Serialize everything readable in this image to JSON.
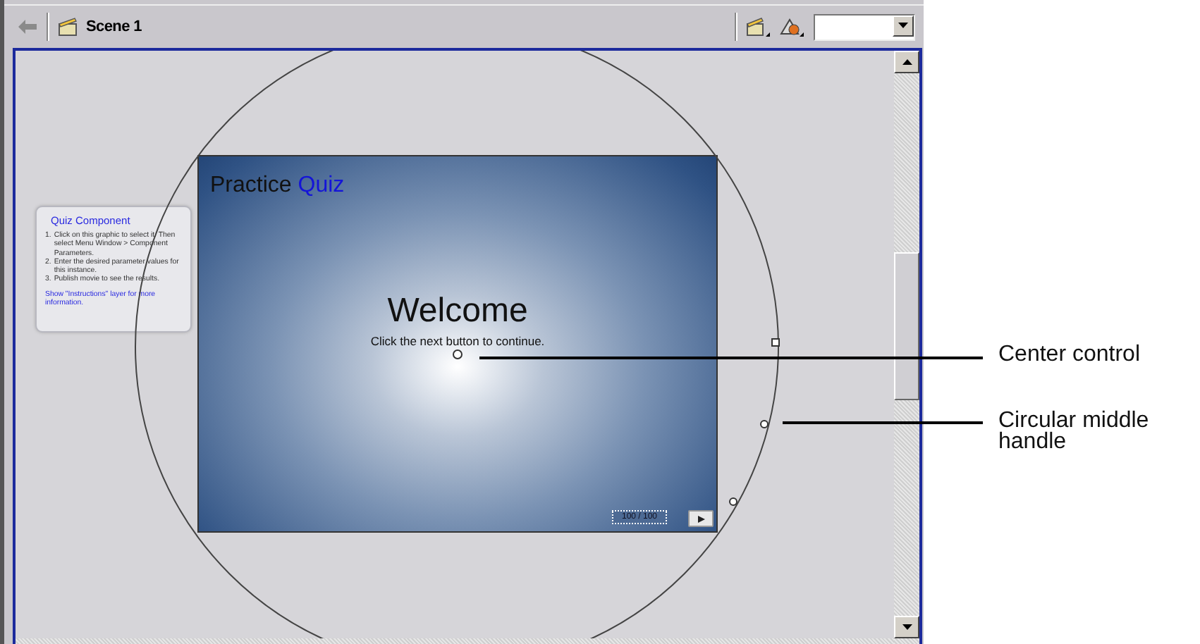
{
  "toolbar": {
    "scene_label": "Scene 1"
  },
  "quiz_panel": {
    "title": "Quiz Component",
    "steps": [
      {
        "number": "1.",
        "text": "Click on this graphic to select it. Then select Menu Window > Component Parameters."
      },
      {
        "number": "2.",
        "text": "Enter the desired parameter values for this instance."
      },
      {
        "number": "3.",
        "text": "Publish movie to see the results."
      }
    ],
    "note": "Show \"Instructions\" layer for more information."
  },
  "slide": {
    "title": "Practice",
    "title_accent": "Quiz",
    "heading": "Welcome",
    "subtitle": "Click the next button to continue.",
    "counter": "100 / 100"
  },
  "callouts": [
    {
      "text": "Center control"
    },
    {
      "text": "Circular middle handle"
    }
  ]
}
